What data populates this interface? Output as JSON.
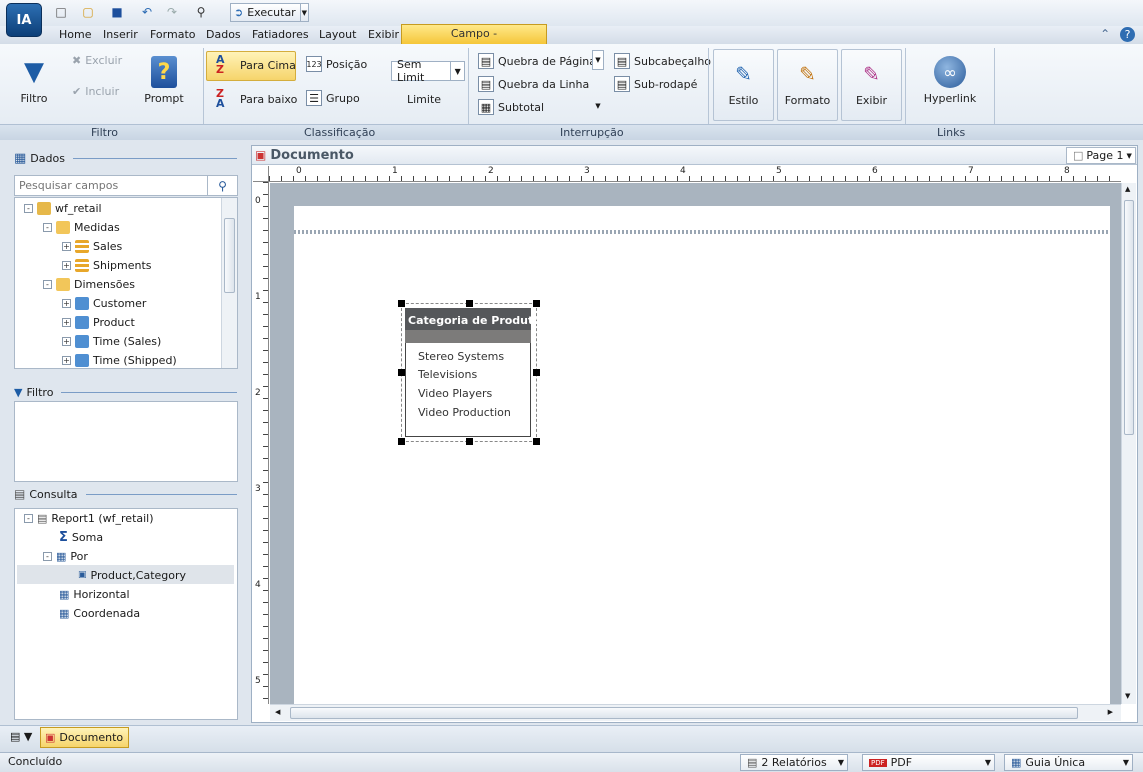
{
  "app": {
    "logo": "IA",
    "run_label": "Executar"
  },
  "menu": {
    "home": "Home",
    "insert": "Inserir",
    "format": "Formato",
    "data": "Dados",
    "slicers": "Fatiadores",
    "layout": "Layout",
    "view": "Exibir",
    "context_tab": "Campo - Product,Category"
  },
  "ribbon": {
    "filtro_group": {
      "label": "Filtro",
      "filtro": "Filtro",
      "excluir": "Excluir",
      "incluir": "Incluir",
      "prompt": "Prompt"
    },
    "sort_group": {
      "label": "Classificação",
      "up": "Para Cima",
      "down": "Para baixo",
      "position": "Posição",
      "group": "Grupo",
      "limit_value": "Sem Limit",
      "limit": "Limite"
    },
    "break_group": {
      "label": "Interrupção",
      "page_break": "Quebra de Página",
      "line_break": "Quebra da Linha",
      "subtotal": "Subtotal",
      "subheader": "Subcabeçalho",
      "subfooter": "Sub-rodapé"
    },
    "style": {
      "estilo": "Estilo",
      "formato": "Formato",
      "exibir": "Exibir"
    },
    "links_group": {
      "label": "Links",
      "hyperlink": "Hyperlink"
    }
  },
  "data_panel": {
    "title": "Dados",
    "search_placeholder": "Pesquisar campos",
    "tree": {
      "root": "wf_retail",
      "measures": "Medidas",
      "measures_items": [
        "Sales",
        "Shipments"
      ],
      "dimensions": "Dimensões",
      "dimension_items": [
        "Customer",
        "Product",
        "Time (Sales)",
        "Time (Shipped)"
      ]
    }
  },
  "filter_panel": {
    "title": "Filtro"
  },
  "query_panel": {
    "title": "Consulta",
    "report": "Report1 (wf_retail)",
    "sum": "Soma",
    "by": "Por",
    "by_field": "Product,Category",
    "horizontal": "Horizontal",
    "coordinate": "Coordenada"
  },
  "document": {
    "title": "Documento",
    "page_selector": "Page 1",
    "h_ruler": [
      "0",
      "1",
      "2",
      "3",
      "4",
      "5",
      "6",
      "7",
      "8"
    ],
    "v_ruler": [
      "0",
      "1",
      "2",
      "3",
      "4",
      "5"
    ],
    "report": {
      "header": "Categoria de Produto",
      "rows": [
        "Stereo Systems",
        "Televisions",
        "Video Players",
        "Video Production"
      ]
    }
  },
  "bottom_tab": {
    "label": "Documento"
  },
  "status": {
    "text": "Concluído",
    "reports": "2 Relatórios",
    "format": "PDF",
    "layout": "Guia Única"
  },
  "colors": {
    "accent": "#f6d46b",
    "header_fill": "#55575a",
    "brand": "#0d3f78"
  }
}
